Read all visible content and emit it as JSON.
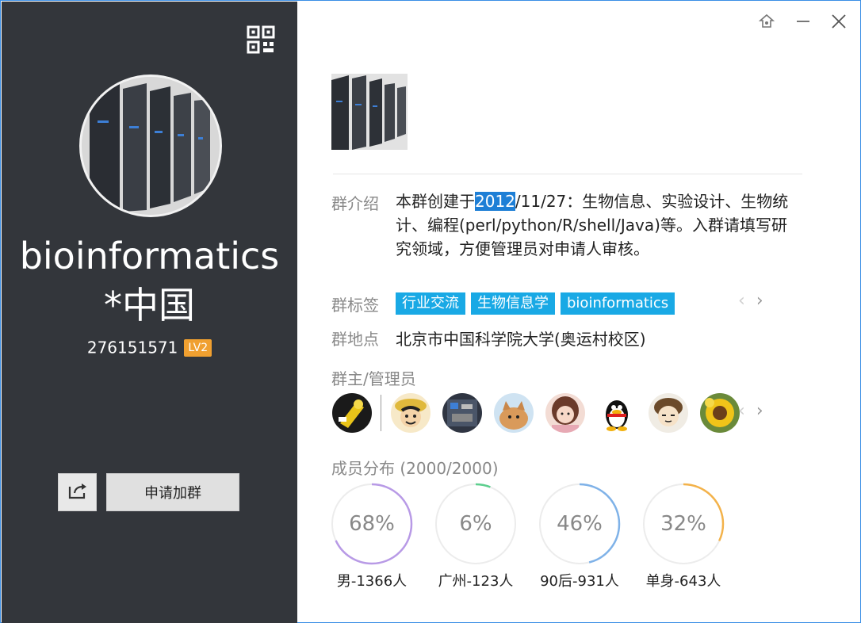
{
  "group": {
    "name_line1": "bioinformatics",
    "name_line2": "*中国",
    "id": "276151571",
    "level": "LV2"
  },
  "buttons": {
    "join_label": "申请加群"
  },
  "labels": {
    "intro": "群介绍",
    "tags": "群标签",
    "location": "群地点",
    "admins": "群主/管理员",
    "distribution": "成员分布",
    "distribution_count": "(2000/2000)"
  },
  "intro": {
    "prefix": "本群创建于",
    "highlight": "2012",
    "rest": "/11/27：生物信息、实验设计、生物统计、编程(perl/python/R/shell/Java)等。入群请填写研究领域，方便管理员对申请人审核。"
  },
  "tags": [
    "行业交流",
    "生物信息学",
    "bioinformatics"
  ],
  "location": "北京市中国科学院大学(奥运村校区)",
  "stats": [
    {
      "value": "68%",
      "label": "男-1366人",
      "fraction": 0.68,
      "color": "#b89ae6"
    },
    {
      "value": "6%",
      "label": "广州-123人",
      "fraction": 0.06,
      "color": "#5dcf8e"
    },
    {
      "value": "46%",
      "label": "90后-931人",
      "fraction": 0.46,
      "color": "#7fb2e8"
    },
    {
      "value": "32%",
      "label": "单身-643人",
      "fraction": 0.32,
      "color": "#f3b24a"
    }
  ],
  "icons": {
    "qr": "qr-code-icon",
    "share": "share-icon",
    "pin": "pin-icon",
    "minimize": "minimize-icon",
    "close": "close-icon",
    "prev": "chevron-left-icon",
    "next": "chevron-right-icon"
  }
}
